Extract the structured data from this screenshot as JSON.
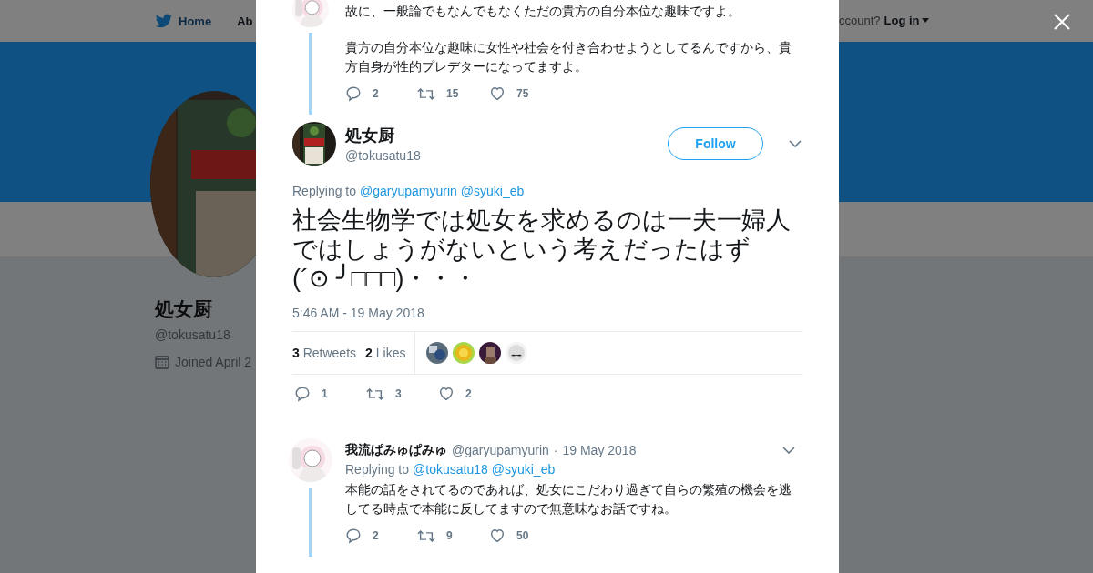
{
  "background_page": {
    "nav": [
      {
        "label": "Home",
        "kind": "bird"
      },
      {
        "label": "Ab",
        "kind": "plain"
      }
    ],
    "account_prompt": "ccount?",
    "login": "Log in",
    "profile": {
      "name": "処女厨",
      "handle": "@tokusatu18",
      "joined": "Joined April 2"
    }
  },
  "previous_tweet": {
    "paragraphs": [
      "故に、一般論でもなんでもなくただの貴方の自分本位な趣味ですよ。",
      "貴方の自分本位な趣味に女性や社会を付き合わせようとしてるんですから、貴方自身が性的プレデターになってますよ。"
    ],
    "actions": {
      "replies": "2",
      "retweets": "15",
      "likes": "75"
    }
  },
  "main_tweet": {
    "name": "処女厨",
    "handle": "@tokusatu18",
    "follow": "Follow",
    "replying_to": "Replying to",
    "mentions": [
      "@garyupamyurin",
      "@syuki_eb"
    ],
    "text_lines": [
      "社会生物学では処女を求めるのは一夫一婦人",
      "ではしょうがないという考えだったはず",
      "(´⊙ ╯□□□)・・・"
    ],
    "timestamp": "5:46 AM - 19 May 2018",
    "retweets_count": "3",
    "retweets_label": "Retweets",
    "likes_count": "2",
    "likes_label": "Likes",
    "likers": [
      {
        "kind": "picture"
      },
      {
        "kind": "picture"
      },
      {
        "kind": "picture"
      },
      {
        "kind": "picture"
      }
    ],
    "actions": {
      "replies": "1",
      "retweets": "3",
      "likes": "2"
    }
  },
  "replies": [
    {
      "name": "我流ぱみゅぱみゅ",
      "handle": "@garyupamyurin",
      "separator": "·",
      "date": "19 May 2018",
      "replying_to": "Replying to",
      "mentions": [
        "@tokusatu18",
        "@syuki_eb"
      ],
      "text": "本能の話をされてるのであれば、処女にこだわり過ぎて自らの繁殖の機会を逃してる時点で本能に反してますので無意味なお話ですね。",
      "actions": {
        "replies": "2",
        "retweets": "9",
        "likes": "50"
      }
    }
  ]
}
